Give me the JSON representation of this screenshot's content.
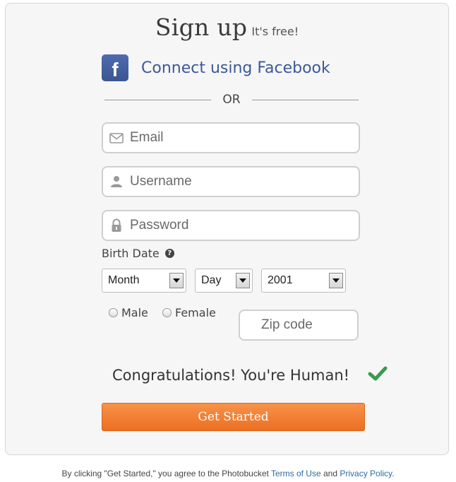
{
  "header": {
    "title": "Sign up",
    "subtitle": "It's free!"
  },
  "facebook": {
    "icon": "facebook-icon",
    "icon_glyph": "f",
    "label": "Connect using Facebook",
    "brand_color": "#3b5998"
  },
  "divider": {
    "label": "OR"
  },
  "form": {
    "email": {
      "placeholder": "Email",
      "value": "",
      "icon": "envelope-icon"
    },
    "username": {
      "placeholder": "Username",
      "value": "",
      "icon": "user-icon"
    },
    "password": {
      "placeholder": "Password",
      "value": "",
      "icon": "lock-icon"
    },
    "birth_date": {
      "label": "Birth Date",
      "help_icon": "question-circle-icon",
      "help_glyph": "?",
      "month": {
        "selected": "Month"
      },
      "day": {
        "selected": "Day"
      },
      "year": {
        "selected": "2001"
      }
    },
    "gender": {
      "male": "Male",
      "female": "Female"
    },
    "zip": {
      "placeholder": "Zip code",
      "value": ""
    }
  },
  "captcha": {
    "message": "Congratulations! You're Human!",
    "icon": "checkmark-icon",
    "color": "#3a9a4e"
  },
  "cta": {
    "label": "Get Started",
    "color": "#ef7a2d"
  },
  "footer": {
    "prefix": "By clicking \"Get Started,\" you agree to the Photobucket",
    "terms": "Terms of Use",
    "and": "and",
    "privacy": "Privacy Policy."
  }
}
